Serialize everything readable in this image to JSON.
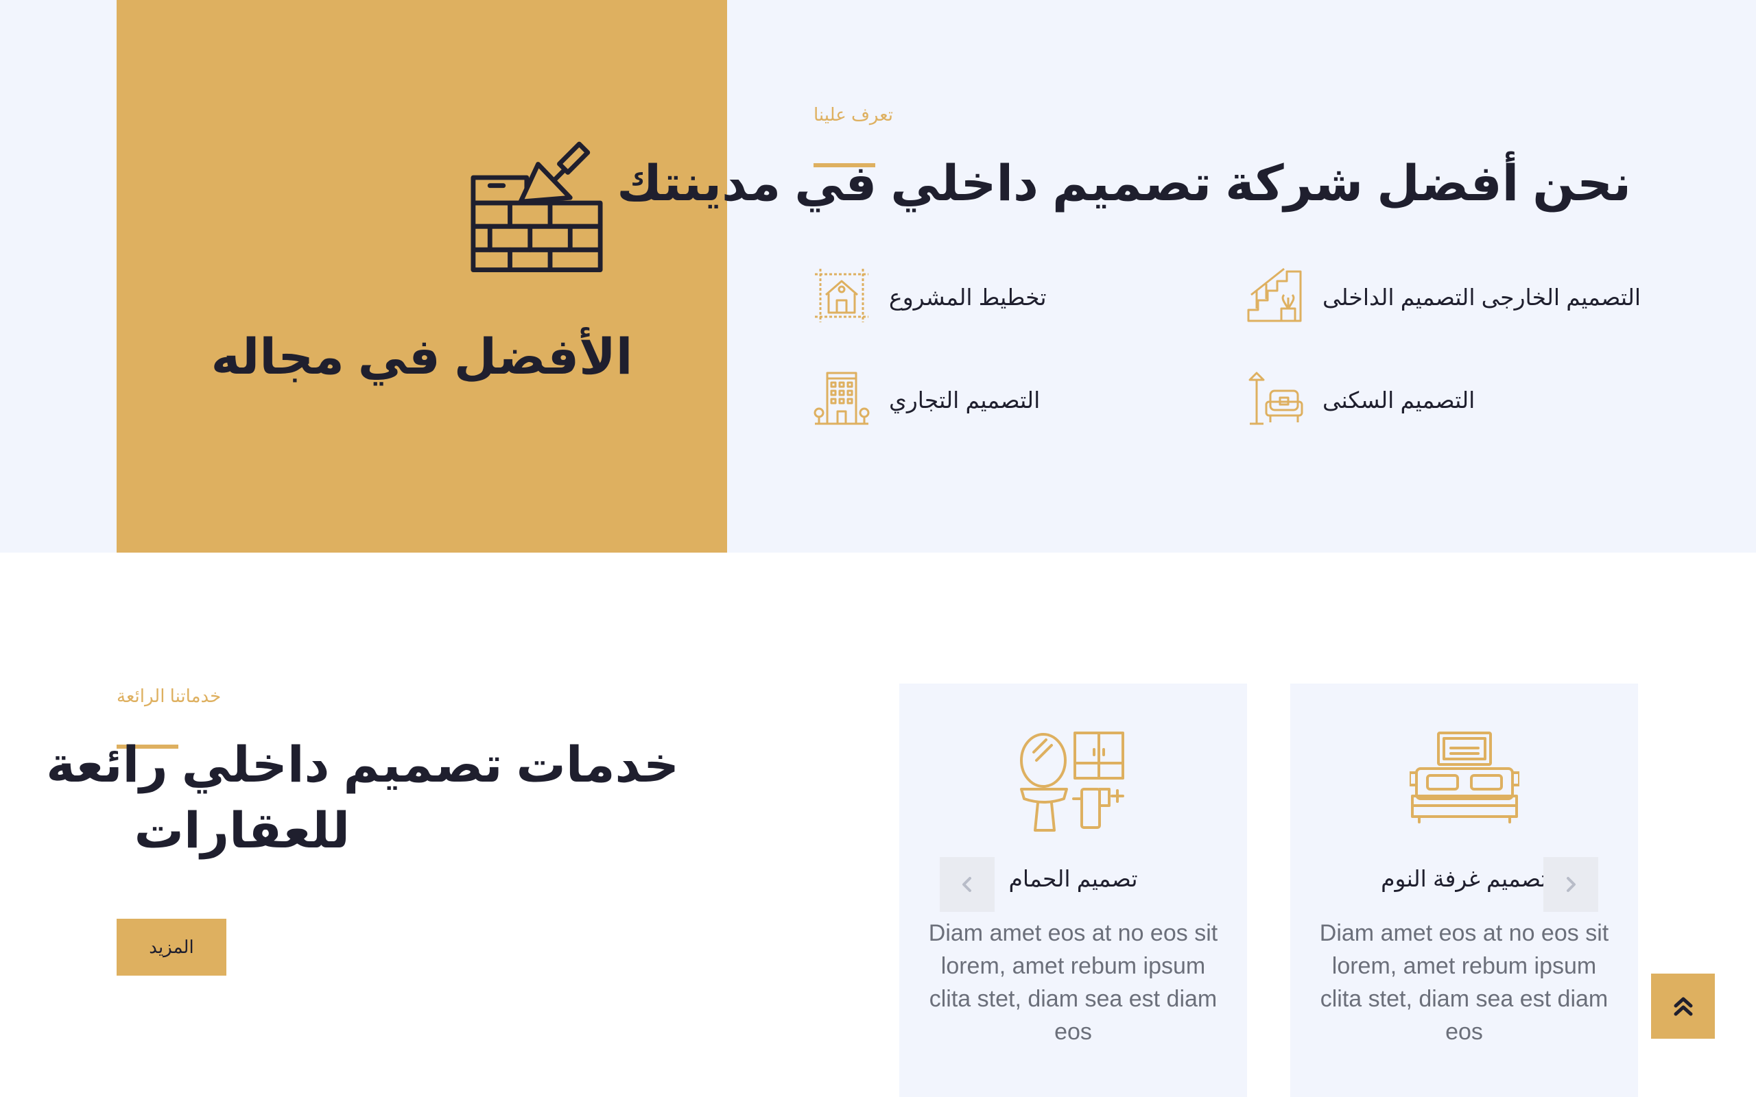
{
  "about": {
    "card_title": "الأفضل في مجاله",
    "eyebrow": "تعرف علينا",
    "heading": "نحن أفضل شركة تصميم داخلي في مدينتك",
    "features": [
      {
        "label": "التصميم الخارجى التصميم الداخلى",
        "icon": "staircase-plant-icon"
      },
      {
        "label": "تخطيط المشروع",
        "icon": "house-plan-icon"
      },
      {
        "label": "التصميم السكنى",
        "icon": "armchair-lamp-icon"
      },
      {
        "label": "التصميم التجاري",
        "icon": "office-building-icon"
      }
    ]
  },
  "services": {
    "eyebrow": "خدماتنا الرائعة",
    "heading_line1": "خدمات تصميم داخلي رائعة",
    "heading_line2": "للعقارات",
    "more_label": "المزيد",
    "cards": [
      {
        "title": "تصميم غرفة النوم",
        "description": "Diam amet eos at no eos sit lorem, amet rebum ipsum clita stet, diam sea est diam eos",
        "icon": "bed-icon"
      },
      {
        "title": "تصميم الحمام",
        "description": "Diam amet eos at no eos sit lorem, amet rebum ipsum clita stet, diam sea est diam eos",
        "icon": "bathroom-sink-icon"
      }
    ]
  },
  "colors": {
    "accent": "#deb060",
    "light_bg": "#f2f5fd",
    "heading": "#1f1f2e",
    "body_text": "#6b6f7a"
  }
}
